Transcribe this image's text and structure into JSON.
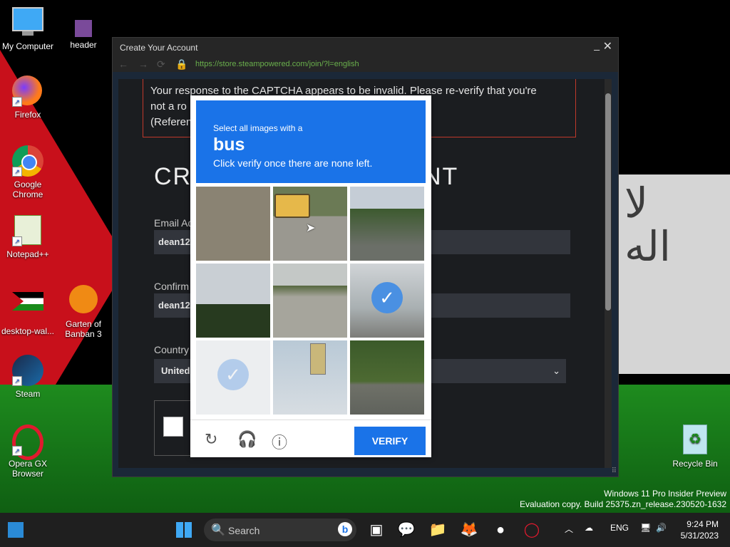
{
  "desktop": {
    "icons": [
      {
        "label": "My Computer"
      },
      {
        "label": "header"
      },
      {
        "label": "Firefox"
      },
      {
        "label": "Google Chrome"
      },
      {
        "label": "Notepad++"
      },
      {
        "label": "desktop-wal..."
      },
      {
        "label": "Garten of Banban 3"
      },
      {
        "label": "Steam"
      },
      {
        "label": "Opera GX Browser"
      },
      {
        "label": "Recycle Bin"
      }
    ],
    "watermark_line1": "Windows 11 Pro Insider Preview",
    "watermark_line2": "Evaluation copy. Build 25375.zn_release.230520-1632"
  },
  "window": {
    "title": "Create Your Account",
    "minimize": "_",
    "close": "✕",
    "url": "https://store.steampowered.com/join/?l=english"
  },
  "page": {
    "error_line1": "Your response to the CAPTCHA appears to be invalid. Please re-verify that you're",
    "error_line2": "not a ro",
    "error_line3": "(Referen",
    "heading_left": "CR",
    "heading_right": "NT",
    "email_label": "Email Ad",
    "email_value": "dean12",
    "confirm_label": "Confirm",
    "confirm_value": "dean12",
    "country_label": "Country",
    "country_value": "United"
  },
  "captcha": {
    "select_text": "Select all images with a",
    "target": "bus",
    "instruction": "Click verify once there are none left.",
    "verify_label": "VERIFY",
    "tiles": [
      "road",
      "bus",
      "palm trees",
      "trees",
      "road",
      "selected",
      "faded selected",
      "traffic light",
      "road"
    ]
  },
  "taskbar": {
    "search_placeholder": "Search",
    "language": "ENG",
    "time": "9:24 PM",
    "date": "5/31/2023"
  }
}
